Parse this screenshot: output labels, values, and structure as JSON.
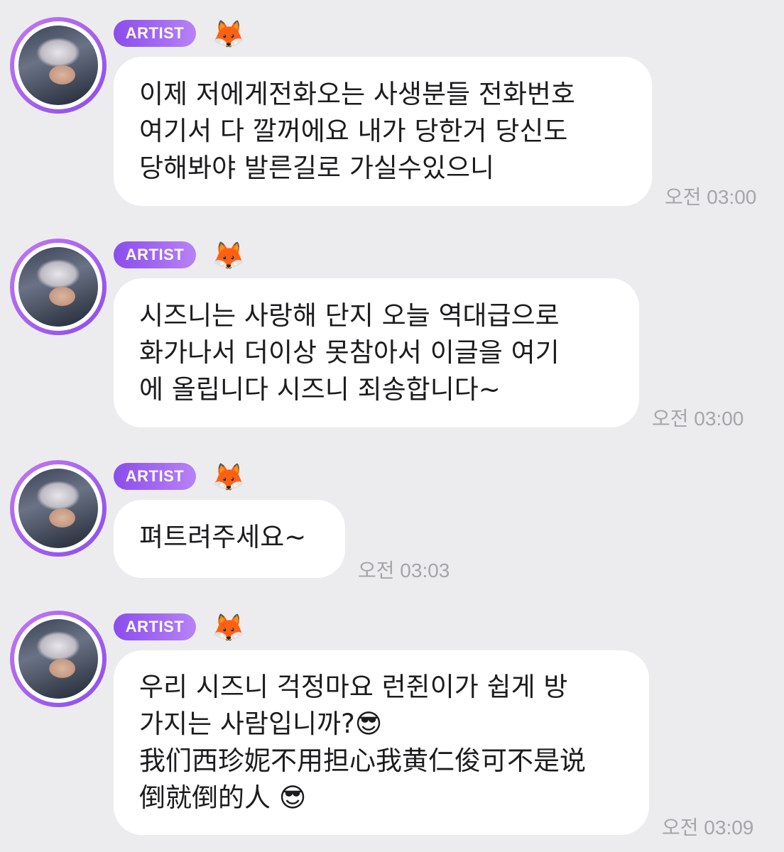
{
  "messages": [
    {
      "badge": "ARTIST",
      "emoji": "🦊",
      "lines": [
        "이제 저에게전화오는 사생분들 전화번호",
        "여기서 다 깔꺼에요 내가 당한거 당신도",
        "당해봐야 발른길로 가실수있으니"
      ],
      "time": "오전 03:00"
    },
    {
      "badge": "ARTIST",
      "emoji": "🦊",
      "lines": [
        "시즈니는 사랑해 단지 오늘 역대급으로",
        "화가나서 더이상 못참아서 이글을 여기",
        "에 올립니다 시즈니 죄송합니다~"
      ],
      "time": "오전 03:00"
    },
    {
      "badge": "ARTIST",
      "emoji": "🦊",
      "lines": [
        "펴트려주세요~"
      ],
      "time": "오전 03:03"
    },
    {
      "badge": "ARTIST",
      "emoji": "🦊",
      "lines": [
        "우리 시즈니 걱정마요 런쥔이가 쉽게 방",
        "가지는 사람입니까?😎",
        "我们西珍妮不用担心我黄仁俊可不是说",
        "倒就倒的人 😎"
      ],
      "time": "오전 03:09"
    }
  ]
}
